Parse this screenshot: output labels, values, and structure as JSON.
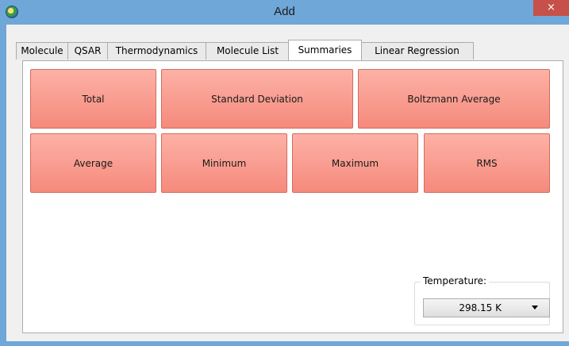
{
  "window": {
    "title": "Add",
    "close_glyph": "×"
  },
  "tabs": [
    {
      "label": "Molecule",
      "active": false
    },
    {
      "label": "QSAR",
      "active": false
    },
    {
      "label": "Thermodynamics",
      "active": false
    },
    {
      "label": "Molecule List",
      "active": false
    },
    {
      "label": "Summaries",
      "active": true
    },
    {
      "label": "Linear Regression",
      "active": false
    }
  ],
  "summaries": {
    "row1": [
      "Total",
      "Standard Deviation",
      "Boltzmann Average"
    ],
    "row2": [
      "Average",
      "Minimum",
      "Maximum",
      "RMS"
    ]
  },
  "temperature": {
    "label": "Temperature:",
    "value": "298.15 K"
  },
  "colors": {
    "titlebar": "#6fa7d8",
    "button_fill": "#f8998b",
    "close": "#c7504a"
  }
}
